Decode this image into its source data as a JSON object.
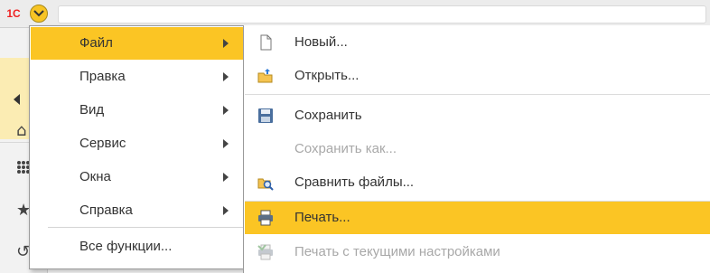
{
  "app": {
    "logo_text": "1С"
  },
  "main_menu": {
    "items": [
      {
        "label": "Файл",
        "has_submenu": true,
        "active": true
      },
      {
        "label": "Правка",
        "has_submenu": true
      },
      {
        "label": "Вид",
        "has_submenu": true
      },
      {
        "label": "Сервис",
        "has_submenu": true
      },
      {
        "label": "Окна",
        "has_submenu": true
      },
      {
        "label": "Справка",
        "has_submenu": true
      }
    ],
    "all_functions": "Все функции..."
  },
  "file_menu": {
    "items": [
      {
        "label": "Новый...",
        "icon": "new-document-icon"
      },
      {
        "label": "Открыть...",
        "icon": "open-folder-icon"
      },
      {
        "label": "Сохранить",
        "icon": "save-icon"
      },
      {
        "label": "Сохранить как...",
        "disabled": true
      },
      {
        "label": "Сравнить файлы...",
        "icon": "compare-files-icon"
      },
      {
        "label": "Печать...",
        "icon": "printer-icon",
        "active": true
      },
      {
        "label": "Печать с текущими настройками",
        "icon": "quick-print-icon",
        "disabled": true
      }
    ]
  },
  "colors": {
    "accent": "#fbc524",
    "panel": "#fbecb3"
  }
}
